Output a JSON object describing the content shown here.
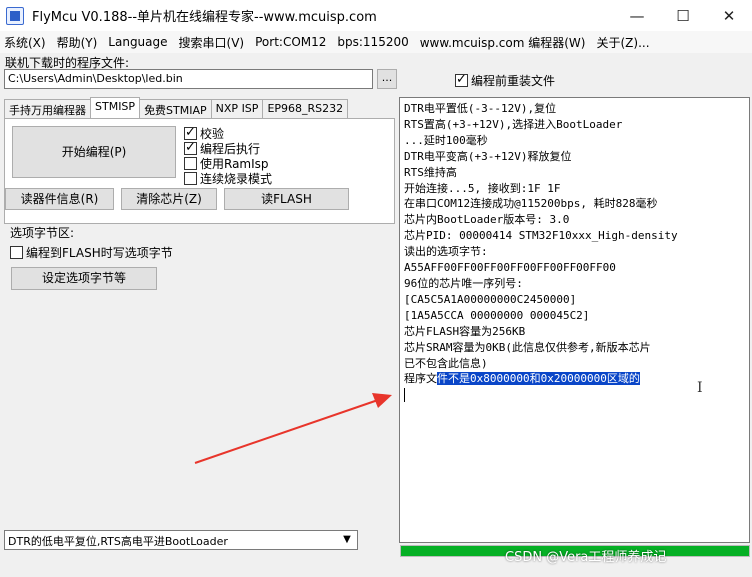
{
  "window": {
    "title": "FlyMcu V0.188--单片机在线编程专家--www.mcuisp.com",
    "minimize": "—",
    "maximize": "☐",
    "close": "✕"
  },
  "menu": [
    "系统(X)",
    "帮助(Y)",
    "Language",
    "搜索串口(V)",
    "Port:COM12",
    "bps:115200",
    "www.mcuisp.com 编程器(W)",
    "关于(Z)..."
  ],
  "file": {
    "label": "联机下载时的程序文件:",
    "path": "C:\\Users\\Admin\\Desktop\\led.bin",
    "browse_label": "...",
    "reload_label": "编程前重装文件",
    "reload_checked": true
  },
  "tabs": [
    "手持万用编程器",
    "STMISP",
    "免费STMIAP",
    "NXP ISP",
    "EP968_RS232"
  ],
  "stmisp": {
    "start_label": "开始编程(P)",
    "options": [
      {
        "label": "校验",
        "checked": true
      },
      {
        "label": "编程后执行",
        "checked": true
      },
      {
        "label": "使用RamIsp",
        "checked": false
      },
      {
        "label": "连续烧录模式",
        "checked": false
      }
    ],
    "read_info_label": "读器件信息(R)",
    "erase_label": "清除芯片(Z)",
    "read_flash_label": "读FLASH"
  },
  "option_bytes": {
    "section_label": "选项字节区:",
    "write_label": "编程到FLASH时写选项字节",
    "write_checked": false,
    "set_label": "设定选项字节等"
  },
  "mode_select": {
    "value": "DTR的低电平复位,RTS高电平进BootLoader",
    "arrow": "▼"
  },
  "log": {
    "lines": [
      "DTR电平置低(-3--12V),复位",
      "RTS置高(+3-+12V),选择进入BootLoader",
      "...延时100毫秒",
      "DTR电平变高(+3-+12V)释放复位",
      "RTS维持高",
      "开始连接...5, 接收到:1F 1F",
      "在串口COM12连接成功@115200bps, 耗时828毫秒",
      "芯片内BootLoader版本号: 3.0",
      "芯片PID: 00000414  STM32F10xxx_High-density",
      "读出的选项字节:",
      "A55AFF00FF00FF00FF00FF00FF00FF00",
      "96位的芯片唯一序列号:",
      "[CA5C5A1A00000000C2450000]",
      "[1A5A5CCA 00000000 000045C2]",
      "芯片FLASH容量为256KB",
      "芯片SRAM容量为0KB(此信息仅供参考,新版本芯片",
      "已不包含此信息)"
    ],
    "last_prefix": "程序文",
    "last_selected": "件不是0x8000000和0x20000000区域的",
    "progress": 1.0,
    "progress_color": "#06b025"
  },
  "watermark": "CSDN @Vera工程师养成记",
  "colors": {
    "arrow": "#e8352b",
    "selection": "#0a46c8"
  }
}
